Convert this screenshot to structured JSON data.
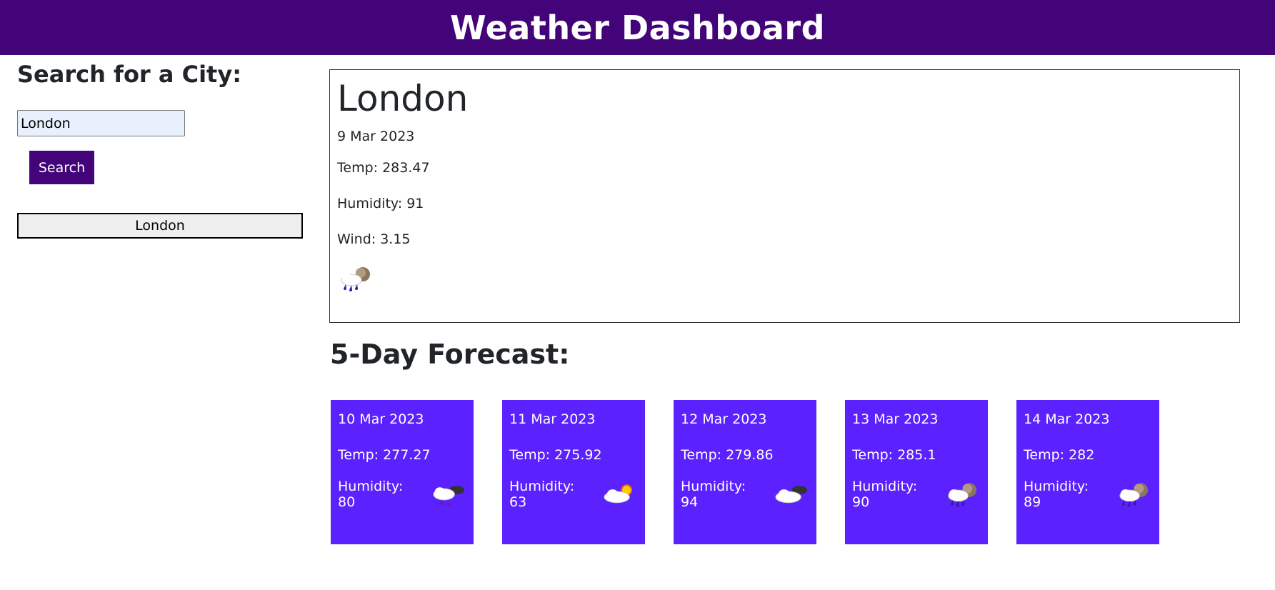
{
  "header": {
    "title": "Weather Dashboard"
  },
  "sidebar": {
    "heading": "Search for a City:",
    "search_value": "London",
    "search_button": "Search",
    "history": [
      "London"
    ]
  },
  "current": {
    "city": "London",
    "date": "9 Mar 2023",
    "temp": "Temp: 283.47",
    "humidity": "Humidity: 91",
    "wind": "Wind: 3.15",
    "icon": "rain-cloud-moon-icon"
  },
  "forecast": {
    "title": "5-Day Forecast:",
    "days": [
      {
        "date": "10 Mar 2023",
        "temp": "Temp: 277.27",
        "humidity": "Humidity: 80",
        "icon": "snow-cloud-moon-icon"
      },
      {
        "date": "11 Mar 2023",
        "temp": "Temp: 275.92",
        "humidity": "Humidity: 63",
        "icon": "cloud-sun-icon"
      },
      {
        "date": "12 Mar 2023",
        "temp": "Temp: 279.86",
        "humidity": "Humidity: 94",
        "icon": "cloud-moon-icon"
      },
      {
        "date": "13 Mar 2023",
        "temp": "Temp: 285.1",
        "humidity": "Humidity: 90",
        "icon": "rain-cloud-moon-icon"
      },
      {
        "date": "14 Mar 2023",
        "temp": "Temp: 282",
        "humidity": "Humidity: 89",
        "icon": "rain-cloud-moon-icon"
      }
    ]
  },
  "colors": {
    "header_bg": "#43047a",
    "card_bg": "#5b21ff",
    "button_bg": "#43047a"
  }
}
